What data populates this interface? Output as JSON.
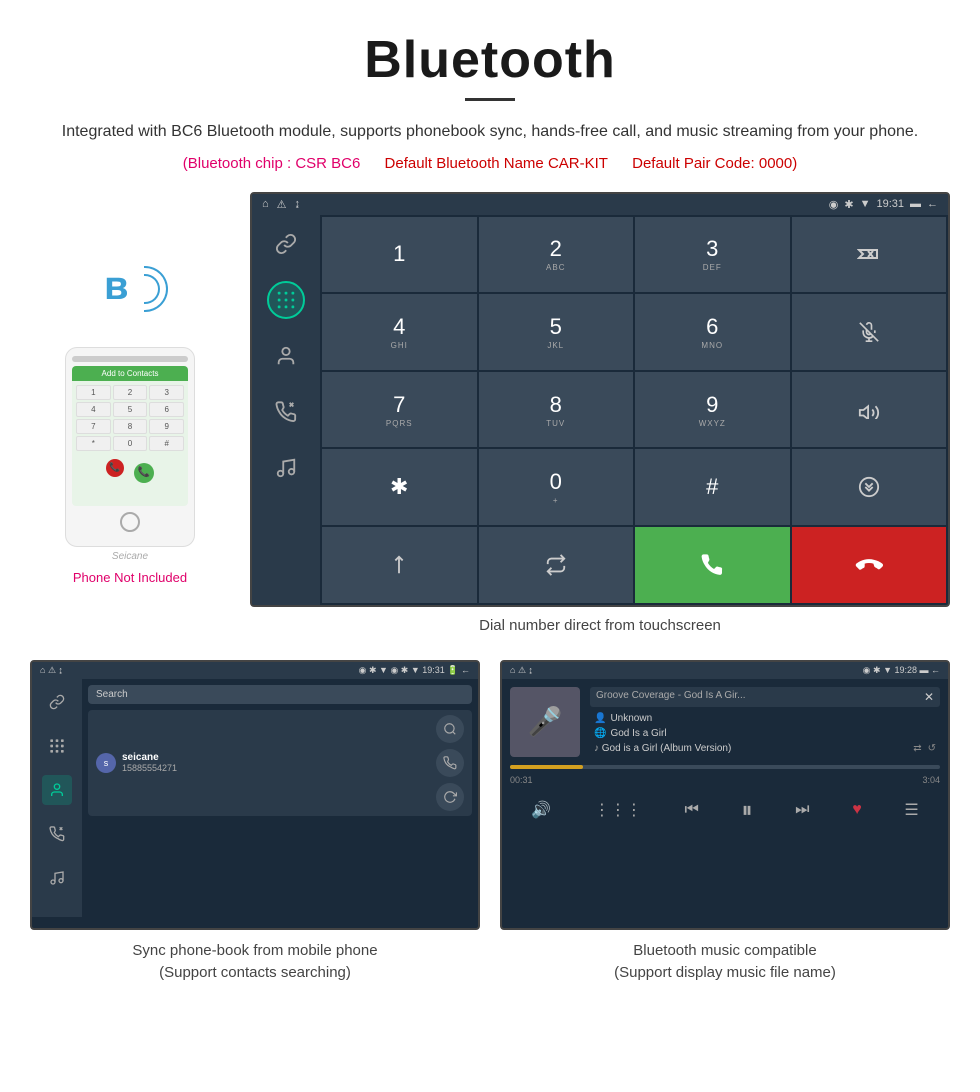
{
  "header": {
    "title": "Bluetooth",
    "description": "Integrated with BC6 Bluetooth module, supports phonebook sync, hands-free call, and music streaming from your phone.",
    "spec1": "(Bluetooth chip : CSR BC6",
    "spec2": "Default Bluetooth Name CAR-KIT",
    "spec3": "Default Pair Code: 0000)",
    "underline": true
  },
  "phone_panel": {
    "phone_not_included": "Phone Not Included",
    "seicane_label": "Seicane"
  },
  "car_screen": {
    "status_left": "▲  ⚠  ↓",
    "status_right": "◉  ✱  ▼  19:31  🔋  ←",
    "time": "19:31",
    "sidebar_icons": [
      "🔗",
      "⌨",
      "👤",
      "📞",
      "🎵"
    ],
    "active_icon_index": 1
  },
  "dialpad": {
    "keys": [
      {
        "main": "1",
        "sub": ""
      },
      {
        "main": "2",
        "sub": "ABC"
      },
      {
        "main": "3",
        "sub": "DEF"
      },
      {
        "main": "⌫",
        "sub": ""
      },
      {
        "main": "4",
        "sub": "GHI"
      },
      {
        "main": "5",
        "sub": "JKL"
      },
      {
        "main": "6",
        "sub": "MNO"
      },
      {
        "main": "🎤",
        "sub": ""
      },
      {
        "main": "7",
        "sub": "PQRS"
      },
      {
        "main": "8",
        "sub": "TUV"
      },
      {
        "main": "9",
        "sub": "WXYZ"
      },
      {
        "main": "🔊",
        "sub": ""
      },
      {
        "main": "✱",
        "sub": ""
      },
      {
        "main": "0",
        "sub": "+"
      },
      {
        "main": "#",
        "sub": ""
      },
      {
        "main": "⇅",
        "sub": ""
      },
      {
        "main": "↑",
        "sub": ""
      },
      {
        "main": "⇄",
        "sub": ""
      },
      {
        "main": "📞",
        "sub": ""
      },
      {
        "main": "📞",
        "sub": ""
      }
    ]
  },
  "dial_caption": "Dial number direct from touchscreen",
  "phonebook_screen": {
    "status_left": "▲  ⚠  ↓",
    "status_right": "◉  ✱  ▼  19:31  🔋  ←",
    "search_placeholder": "Search",
    "contact": {
      "initial": "s",
      "name": "seicane",
      "number": "15885554271"
    },
    "caption_line1": "Sync phone-book from mobile phone",
    "caption_line2": "(Support contacts searching)"
  },
  "music_screen": {
    "status_left": "▲  ⚠  ↓",
    "status_right": "◉  ✱  ▼  19:28  🔋  ←",
    "title": "Groove Coverage - God Is A Gir...",
    "artist": "Unknown",
    "album": "God Is a Girl",
    "track": "God is a Girl (Album Version)",
    "time_current": "00:31",
    "time_total": "3:04",
    "progress_percent": 17,
    "caption_line1": "Bluetooth music compatible",
    "caption_line2": "(Support display music file name)"
  }
}
